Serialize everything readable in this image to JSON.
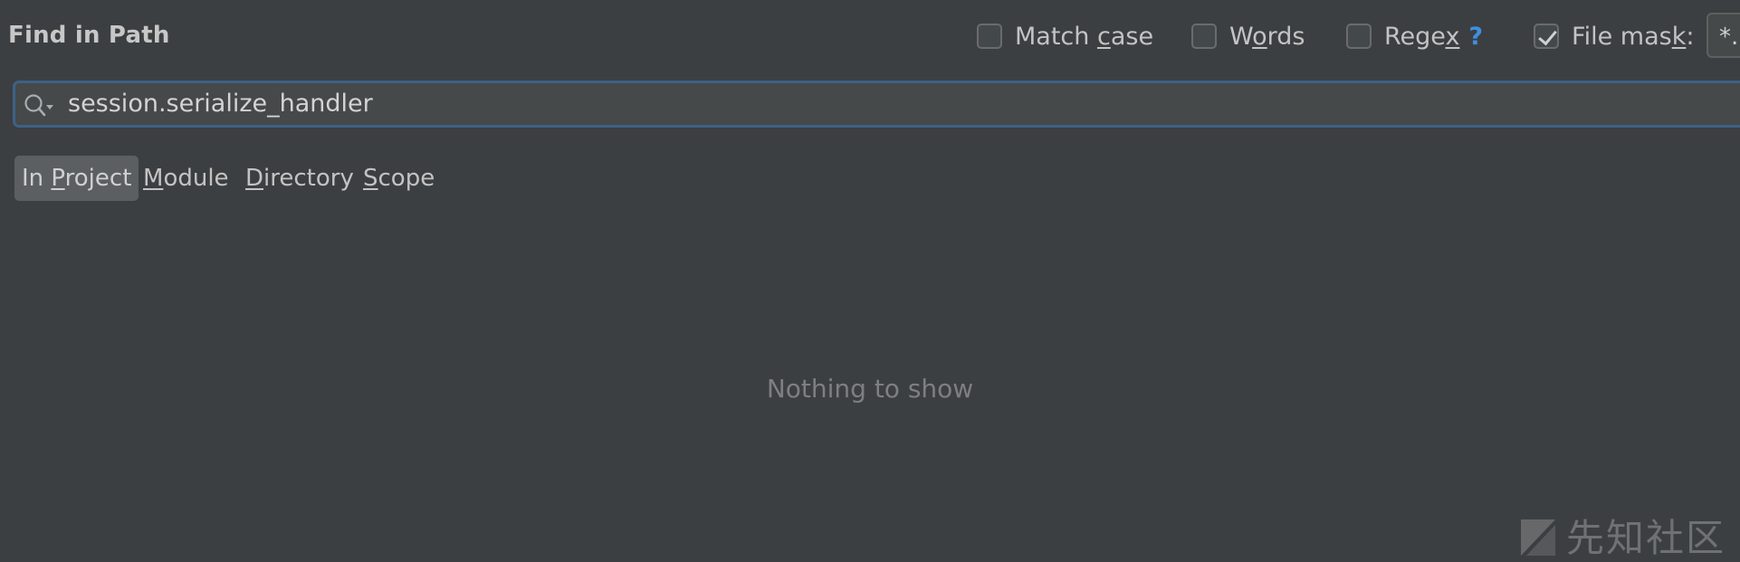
{
  "header": {
    "title": "Find in Path"
  },
  "options": {
    "match_case": {
      "label_pre": "Match ",
      "label_u": "c",
      "label_post": "ase",
      "checked": false
    },
    "words": {
      "label_pre": "W",
      "label_u": "o",
      "label_post": "rds",
      "checked": false
    },
    "regex": {
      "label_pre": "Rege",
      "label_u": "x",
      "label_post": "",
      "help": "?",
      "checked": false
    },
    "file_mask": {
      "label_pre": "File mas",
      "label_u": "k",
      "label_post": ":",
      "checked": true,
      "value": "*."
    }
  },
  "search": {
    "value": "session.serialize_handler",
    "icon": "search-icon"
  },
  "scope_tabs": [
    {
      "pre": "In ",
      "u": "P",
      "post": "roject",
      "active": true
    },
    {
      "pre": "",
      "u": "M",
      "post": "odule",
      "active": false
    },
    {
      "pre": "",
      "u": "D",
      "post": "irectory",
      "active": false
    },
    {
      "pre": "",
      "u": "S",
      "post": "cope",
      "active": false
    }
  ],
  "results": {
    "empty_text": "Nothing to show"
  },
  "watermark": {
    "text": "先知社区"
  },
  "colors": {
    "background": "#3c3f41",
    "input_focus_border": "#3d6185",
    "help_accent": "#3d8fe0",
    "active_tab": "#5b5f62"
  }
}
